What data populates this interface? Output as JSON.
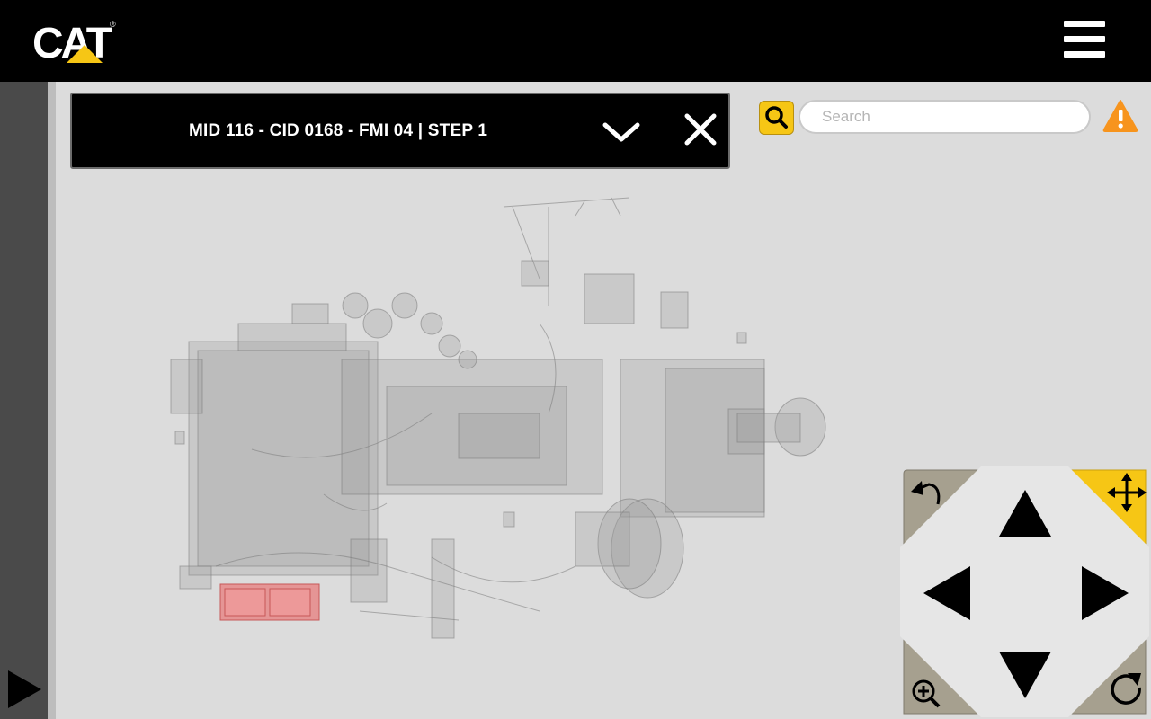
{
  "app": {
    "brand": "CAT",
    "registered_mark": "®"
  },
  "step_header": {
    "title": "MID 116 - CID 0168 - FMI 04 | STEP 1"
  },
  "search": {
    "placeholder": "Search",
    "value": ""
  },
  "icons": {
    "menu": "hamburger-menu-icon",
    "collapse": "chevron-down-icon",
    "close": "close-icon",
    "search": "magnifier-icon",
    "alert": "warning-triangle-icon",
    "sidebar_toggle": "play-triangle-icon",
    "reset_view": "undo-arrow-icon",
    "pan_mode": "move-arrows-icon",
    "zoom": "zoom-in-icon",
    "rotate": "rotate-icon"
  },
  "colors": {
    "brand_yellow": "#f6c615",
    "alert_orange": "#f7941d",
    "header_black": "#000000",
    "viewport_gray": "#dcdcdc",
    "highlight_red": "#e87d7d"
  },
  "model": {
    "highlighted_component": "red-highlighted-battery"
  }
}
